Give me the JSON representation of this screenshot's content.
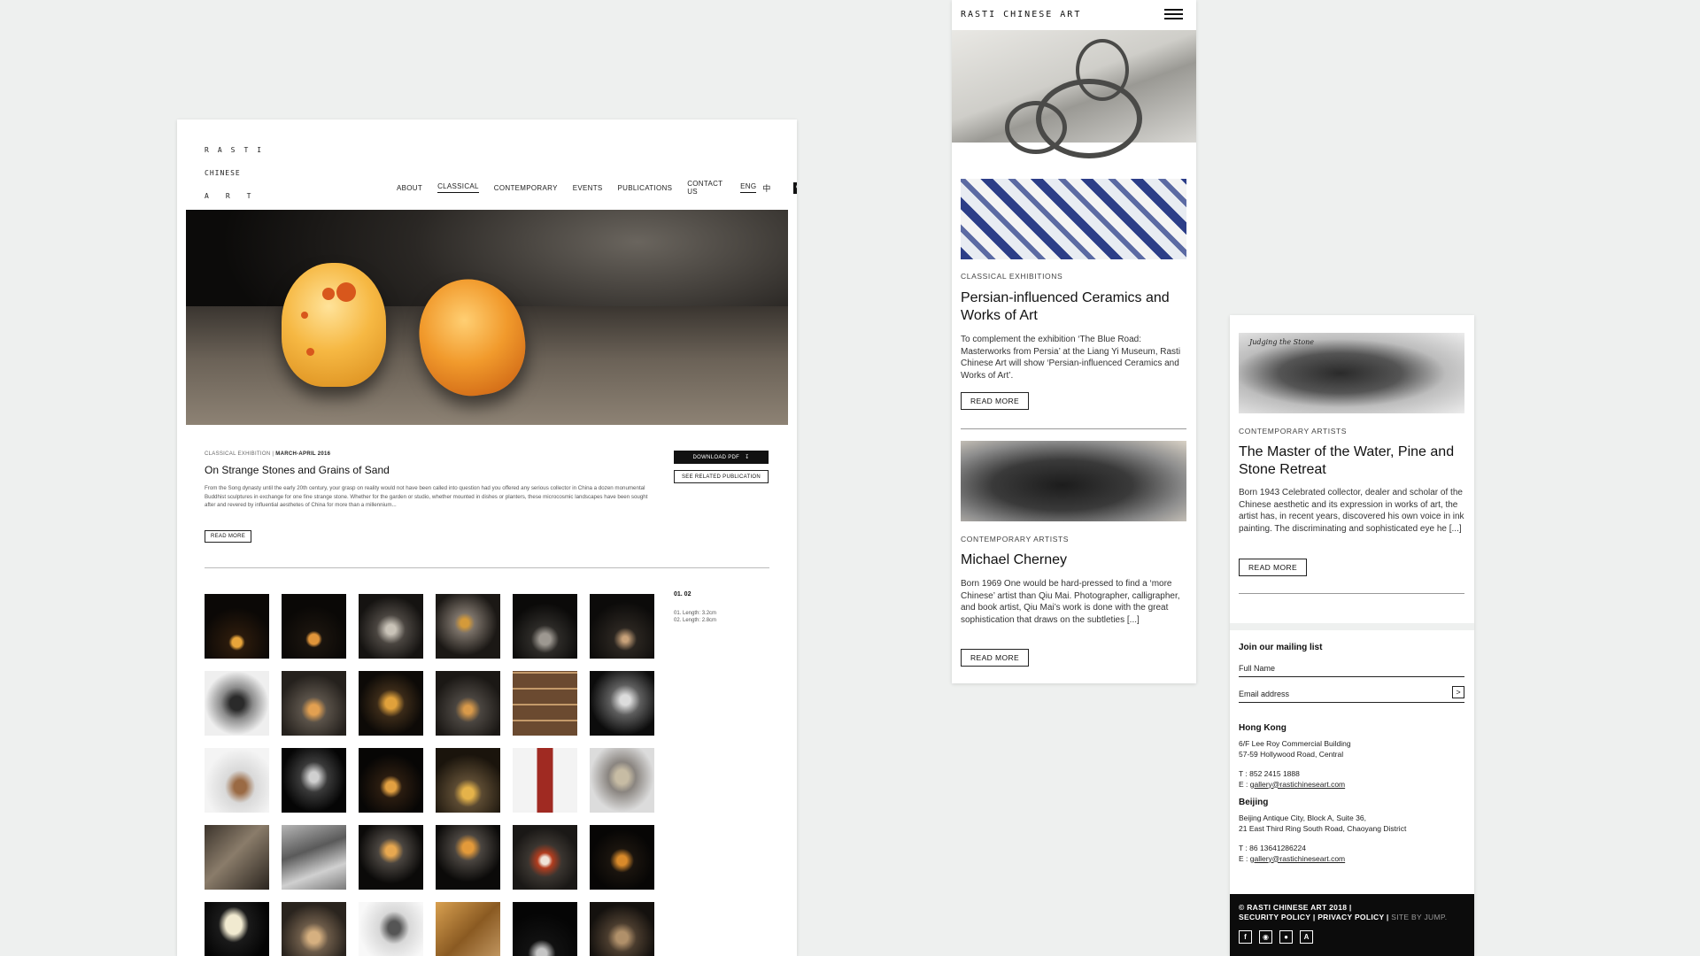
{
  "desktop": {
    "logo": {
      "line1": "RASTI",
      "line2": "CHINESE",
      "line3": "ART"
    },
    "nav": {
      "about": "ABOUT",
      "classical": "CLASSICAL",
      "contemporary": "CONTEMPORARY",
      "events": "EVENTS",
      "publications": "PUBLICATIONS",
      "contact": "CONTACT US",
      "lang": "ENG",
      "lang_alt": "中"
    },
    "article": {
      "category": "CLASSICAL EXHIBITION |",
      "date": "MARCH-APRIL 2016",
      "title": "On Strange Stones and Grains of Sand",
      "description": "From the Song dynasty until the early 20th century, your grasp on reality would not have been called into question had you offered any serious collector in China a dozen monumental Buddhist sculptures in exchange for one fine strange stone. Whether for the garden or studio, whether mounted in dishes or planters, these microcosmic landscapes have been sought after and revered by influential aesthetes of China for more than a millennium...",
      "read_more": "READ MORE",
      "download_pdf": "DOWNLOAD PDF",
      "see_related": "SEE RELATED PUBLICATION"
    },
    "gallery": {
      "counter": "01. 02",
      "dim1": "01. Length: 3.2cm",
      "dim2": "02. Length: 2.8cm"
    }
  },
  "mobile1": {
    "logo": "RASTI CHINESE ART",
    "card1": {
      "category": "CLASSICAL EXHIBITIONS",
      "title": "Persian-influenced Ceramics and Works of Art",
      "description": "To complement the exhibition ‘The Blue Road: Masterworks from Persia’ at the Liang Yi Museum, Rasti Chinese Art will show ‘Persian-influenced Ceramics and Works of Art’.",
      "button": "READ MORE"
    },
    "card2": {
      "category": "CONTEMPORARY ARTISTS",
      "title": "Michael Cherney",
      "description": "Born 1969 One would be hard-pressed to find a ‘more Chinese’ artist than Qiu Mai. Photographer, calligrapher, and book artist, Qiu Mai’s work is done with the great sophistication that draws on the subtleties [...]",
      "button": "READ MORE"
    }
  },
  "mobile2": {
    "image_caption": "Judging the Stone",
    "card": {
      "category": "CONTEMPORARY ARTISTS",
      "title": "The Master of the Water, Pine and Stone Retreat",
      "description": "Born 1943 Celebrated collector, dealer and scholar of the Chinese aesthetic and its expression in works of art, the artist has, in recent years, discovered his own voice in ink painting. The discriminating and sophisticated eye he [...]",
      "button": "READ MORE"
    },
    "mailing": {
      "title": "Join our mailing list",
      "name_placeholder": "Full Name",
      "email_placeholder": "Email address",
      "submit": ">"
    },
    "hong_kong": {
      "city": "Hong Kong",
      "addr1": "6/F Lee Roy Commercial Building",
      "addr2": "57-59 Hollywood Road, Central",
      "phone": "T : 852 2415 1888",
      "email_prefix": "E : ",
      "email": "gallery@rastichineseart.com"
    },
    "beijing": {
      "city": "Beijing",
      "addr1": "Beijing Antique City, Block A, Suite 36,",
      "addr2": "21 East Third Ring South Road, Chaoyang District",
      "phone": "T : 86 13641286224",
      "email_prefix": "E : ",
      "email": "gallery@rastichineseart.com"
    },
    "footer": {
      "copyright": "© RASTI CHINESE ART 2018 |",
      "security": "SECURITY POLICY",
      "sep": " | ",
      "privacy": "PRIVACY POLICY",
      "sep2": " | ",
      "site_by": "SITE BY JUMP."
    }
  }
}
